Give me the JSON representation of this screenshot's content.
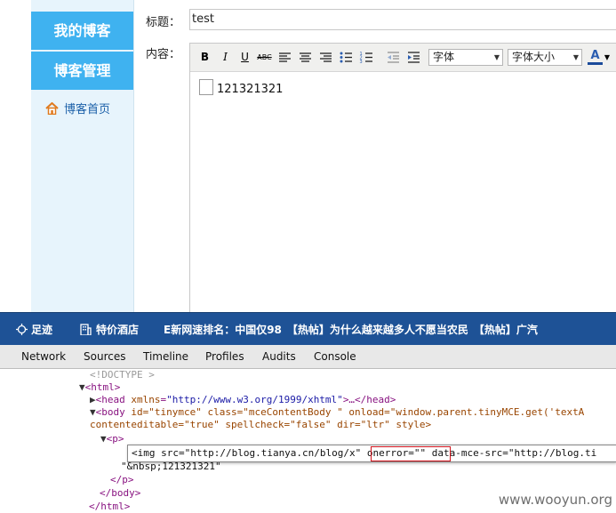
{
  "sidebar": {
    "items": [
      {
        "label": "我的博客"
      },
      {
        "label": "博客管理"
      }
    ],
    "home_link": "博客首页"
  },
  "form": {
    "title_label": "标题：",
    "title_value": "test",
    "content_label": "内容："
  },
  "toolbar": {
    "bold": "B",
    "italic": "I",
    "underline": "U",
    "strike": "ABC",
    "font_select": "字体",
    "size_select": "字体大小",
    "font_color": "A"
  },
  "editor": {
    "content": "121321321"
  },
  "browser_bar": {
    "item1": "足迹",
    "item2": "特价酒店",
    "ticker": "E新网速排名：中国仅98　【热帖】为什么越来越多人不愿当农民　【热帖】广汽"
  },
  "devtools": {
    "tabs": [
      "Network",
      "Sources",
      "Timeline",
      "Profiles",
      "Audits",
      "Console"
    ],
    "lines": {
      "doctype": "<!DOCTYPE >",
      "html_open": "<html>",
      "head_tag": "<head",
      "head_attr": "xmlns",
      "head_val": "\"http://www.w3.org/1999/xhtml\"",
      "head_rest": ">…</head>",
      "body_tag": "<body",
      "body_attrs": " id=\"tinymce\" class=\"mceContentBody \" onload=\"window.parent.tinyMCE.get('textA",
      "body_cont": "contenteditable=\"true\" spellcheck=\"false\" dir=\"ltr\" style>",
      "p_open": "<p>",
      "img_before": "<img src=\"http://blog.tianya.cn/blog/x\" ",
      "img_onerror": "onerror=\"\"",
      "img_after": " data-mce-src=\"http://blog.ti",
      "text_node": "\"&nbsp;121321321\"",
      "p_close": "</p>",
      "body_close": "</body>",
      "html_close": "</html>"
    }
  },
  "watermark": "www.wooyun.org",
  "colors": {
    "sidebar_button": "#3fb2f0",
    "sidebar_bg": "#e7f4fc",
    "browser_bar": "#1e5296",
    "highlight_box": "#d0121b"
  }
}
